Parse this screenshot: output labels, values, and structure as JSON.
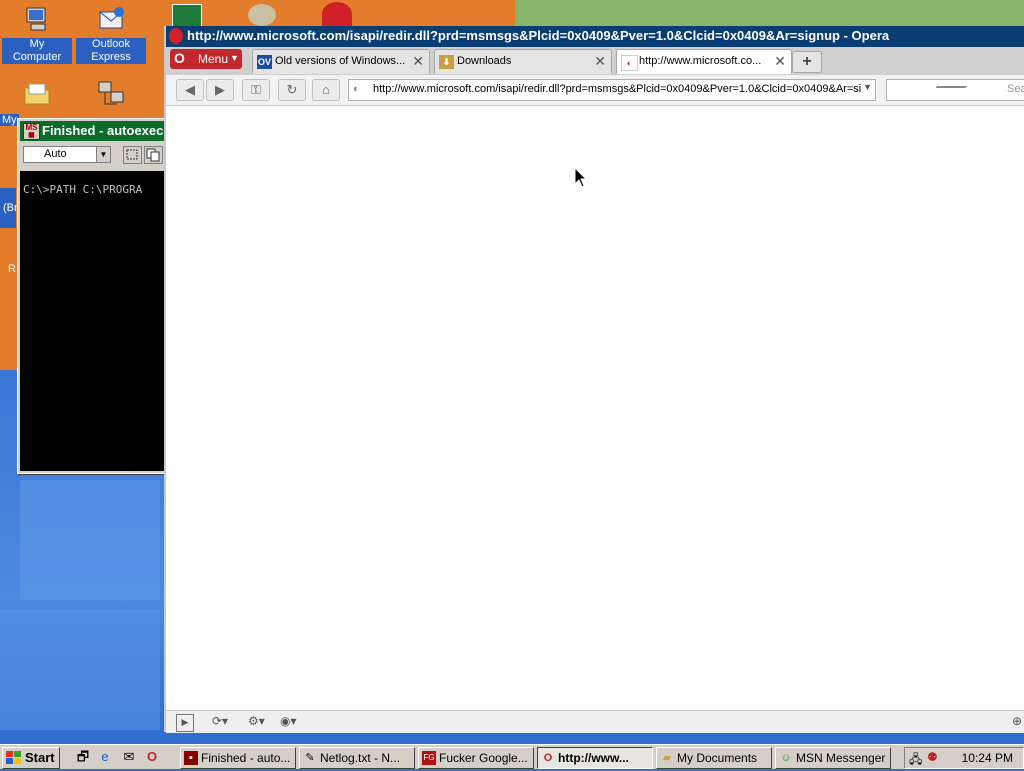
{
  "desktop": {
    "icons": [
      {
        "label": "My Computer",
        "icon": "computer-icon"
      },
      {
        "label": "Outlook Express",
        "icon": "mail-icon"
      },
      {
        "label": "My",
        "icon": "folder-icon"
      },
      {
        "label": "",
        "icon": "network-icon"
      }
    ],
    "partial_labels": [
      "(Br",
      "R"
    ]
  },
  "console": {
    "title": "Finished - autoexec",
    "font_select": "Auto",
    "line": "C:\\>PATH C:\\PROGRA"
  },
  "browser": {
    "title": "http://www.microsoft.com/isapi/redir.dll?prd=msmsgs&Plcid=0x0409&Pver=1.0&Clcid=0x0409&Ar=signup - Opera",
    "menu_label": "Menu",
    "tabs": [
      {
        "label": "Old versions of Windows...",
        "favicon": "OV",
        "active": false
      },
      {
        "label": "Downloads",
        "favicon": "download-icon",
        "active": false
      },
      {
        "label": "http://www.microsoft.co...",
        "favicon": "page-icon",
        "active": true
      }
    ],
    "address": "http://www.microsoft.com/isapi/redir.dll?prd=msmsgs&Plcid=0x0409&Pver=1.0&Clcid=0x0409&Ar=si",
    "search_placeholder": "Sea"
  },
  "taskbar": {
    "start_label": "Start",
    "items": [
      {
        "label": "Finished - auto...",
        "icon": "msdos-icon",
        "pressed": false
      },
      {
        "label": "Netlog.txt - N...",
        "icon": "notepad-icon",
        "pressed": false
      },
      {
        "label": "Fucker Google...",
        "icon": "fg-icon",
        "pressed": false
      },
      {
        "label": "http://www...",
        "icon": "opera-icon",
        "pressed": true
      },
      {
        "label": "My Documents",
        "icon": "folder-icon",
        "pressed": false
      },
      {
        "label": "MSN Messenger",
        "icon": "msn-icon",
        "pressed": false
      }
    ],
    "clock": "10:24 PM"
  },
  "colors": {
    "console_title": "#0a6b2a",
    "browser_title": "#0a3e73",
    "opera_red": "#c4262e"
  }
}
